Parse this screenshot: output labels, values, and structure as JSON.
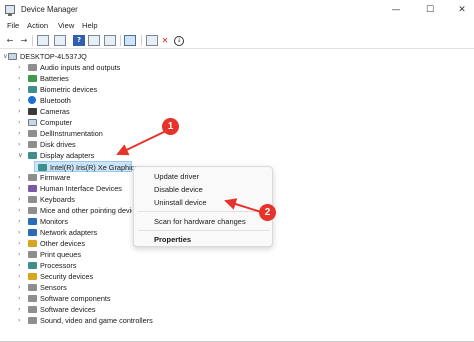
{
  "window": {
    "title": "Device Manager",
    "controls": {
      "minimize": "—",
      "maximize": "☐",
      "close": "✕"
    }
  },
  "menu": [
    "File",
    "Action",
    "View",
    "Help"
  ],
  "toolbar": [
    "back-arrow-icon",
    "forward-arrow-icon",
    "properties-icon",
    "show-hide-icon",
    "help-icon",
    "driver-icon",
    "monitor-icon",
    "add-device-icon",
    "delete-icon",
    "download-icon"
  ],
  "tree": {
    "root": "DESKTOP-4L537JQ",
    "items": [
      {
        "label": "Audio inputs and outputs",
        "expanded": false
      },
      {
        "label": "Batteries",
        "expanded": false
      },
      {
        "label": "Biometric devices",
        "expanded": false
      },
      {
        "label": "Bluetooth",
        "expanded": false
      },
      {
        "label": "Cameras",
        "expanded": false
      },
      {
        "label": "Computer",
        "expanded": false
      },
      {
        "label": "DellInstrumentation",
        "expanded": false
      },
      {
        "label": "Disk drives",
        "expanded": false
      },
      {
        "label": "Display adapters",
        "expanded": true
      },
      {
        "label": "Intel(R) Iris(R) Xe Graphics",
        "child": true,
        "selected": true
      },
      {
        "label": "Firmware",
        "expanded": false
      },
      {
        "label": "Human Interface Devices",
        "expanded": false
      },
      {
        "label": "Keyboards",
        "expanded": false
      },
      {
        "label": "Mice and other pointing devices",
        "expanded": false
      },
      {
        "label": "Monitors",
        "expanded": false
      },
      {
        "label": "Network adapters",
        "expanded": false
      },
      {
        "label": "Other devices",
        "expanded": false
      },
      {
        "label": "Print queues",
        "expanded": false
      },
      {
        "label": "Processors",
        "expanded": false
      },
      {
        "label": "Security devices",
        "expanded": false
      },
      {
        "label": "Sensors",
        "expanded": false
      },
      {
        "label": "Software components",
        "expanded": false
      },
      {
        "label": "Software devices",
        "expanded": false
      },
      {
        "label": "Sound, video and game controllers",
        "expanded": false
      }
    ]
  },
  "context_menu": {
    "items": [
      "Update driver",
      "Disable device",
      "Uninstall device",
      "Scan for hardware changes",
      "Properties"
    ]
  },
  "annotations": {
    "badge1": "1",
    "badge2": "2",
    "color": "#e7332a"
  }
}
